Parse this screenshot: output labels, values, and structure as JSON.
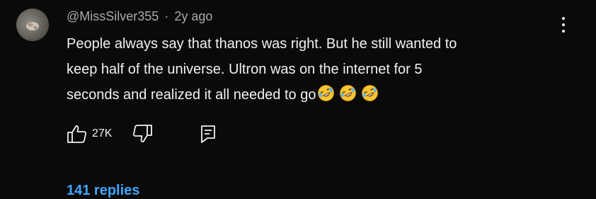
{
  "comment": {
    "author": "@MissSilver355",
    "separator": "·",
    "time": "2y ago",
    "lines": [
      "People always say that thanos was right. But he still wanted to",
      "keep half of the universe. Ultron was on the internet for 5",
      "seconds and realized it all needed to go"
    ],
    "emojis": [
      "rolling-on-floor-laughing-emoji",
      "rolling-on-floor-laughing-emoji",
      "rolling-on-floor-laughing-emoji"
    ],
    "like_count": "27K",
    "replies_label": "141 replies"
  },
  "icons": {
    "menu": "more-vertical-icon",
    "like": "thumbs-up-icon",
    "dislike": "thumbs-down-icon",
    "reply": "reply-icon"
  },
  "colors": {
    "background": "#0a0a0a",
    "text": "#f1f1f1",
    "meta": "#aaaaaa",
    "link": "#3ea6ff"
  }
}
